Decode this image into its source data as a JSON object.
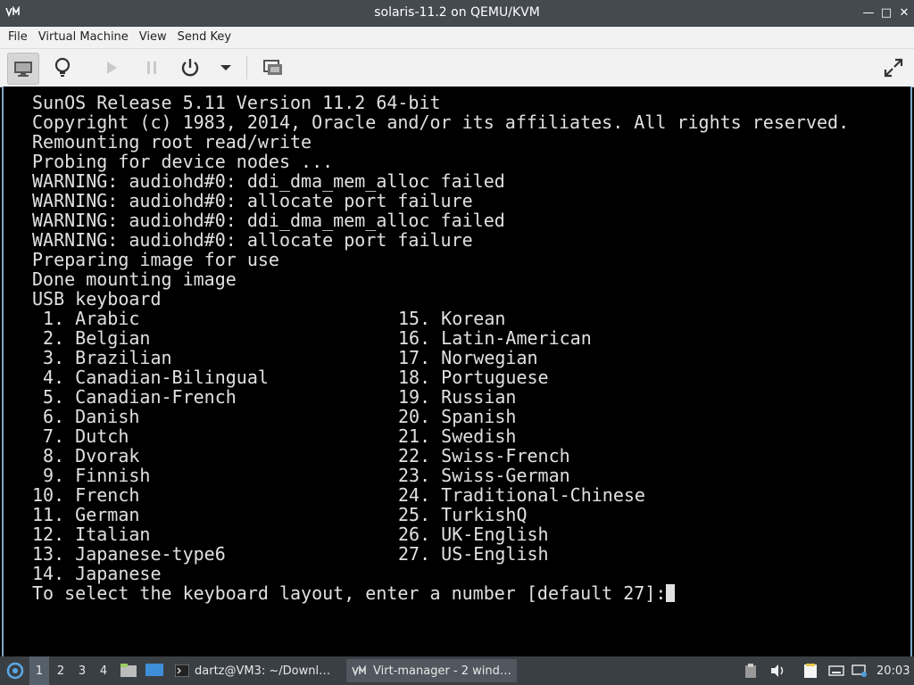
{
  "window": {
    "title": "solaris-11.2 on QEMU/KVM"
  },
  "menu": [
    "File",
    "Virtual Machine",
    "View",
    "Send Key"
  ],
  "toolbar": {
    "items": [
      "show-console",
      "show-details",
      "run",
      "pause",
      "shutdown",
      "shutdown-menu",
      "screenshot-snapshots",
      "fullscreen"
    ]
  },
  "console": {
    "header_lines": [
      "SunOS Release 5.11 Version 11.2 64-bit",
      "Copyright (c) 1983, 2014, Oracle and/or its affiliates. All rights reserved.",
      "Remounting root read/write",
      "Probing for device nodes ...",
      "WARNING: audiohd#0: ddi_dma_mem_alloc failed",
      "WARNING: audiohd#0: allocate port failure",
      "WARNING: audiohd#0: ddi_dma_mem_alloc failed",
      "WARNING: audiohd#0: allocate port failure",
      "Preparing image for use",
      "Done mounting image",
      "USB keyboard"
    ],
    "options_col1": [
      " 1. Arabic",
      " 2. Belgian",
      " 3. Brazilian",
      " 4. Canadian-Bilingual",
      " 5. Canadian-French",
      " 6. Danish",
      " 7. Dutch",
      " 8. Dvorak",
      " 9. Finnish",
      "10. French",
      "11. German",
      "12. Italian",
      "13. Japanese-type6",
      "14. Japanese"
    ],
    "options_col2": [
      "15. Korean",
      "16. Latin-American",
      "17. Norwegian",
      "18. Portuguese",
      "19. Russian",
      "20. Spanish",
      "21. Swedish",
      "22. Swiss-French",
      "23. Swiss-German",
      "24. Traditional-Chinese",
      "25. TurkishQ",
      "26. UK-English",
      "27. US-English"
    ],
    "prompt": "To select the keyboard layout, enter a number [default 27]:"
  },
  "taskbar": {
    "workspaces": [
      "1",
      "2",
      "3",
      "4"
    ],
    "active_workspace": "1",
    "tasks": [
      {
        "label": "dartz@VM3: ~/Downl…",
        "icon": "terminal-icon"
      },
      {
        "label": "Virt-manager - 2 wind…",
        "icon": "virt-manager-icon"
      }
    ],
    "clock": "20:03"
  },
  "colors": {
    "titlebar": "#444a50",
    "menubar": "#f2f2f2",
    "console_bg": "#000000",
    "console_text": "#e0e0e0",
    "taskbar": "#3a3f44"
  }
}
